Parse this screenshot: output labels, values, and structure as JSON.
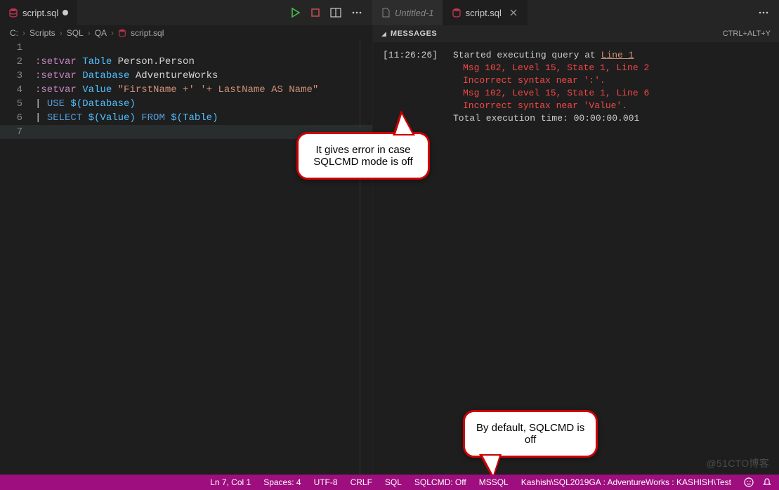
{
  "tabs": {
    "left": {
      "name": "script.sql"
    },
    "right_inactive": "Untitled-1",
    "right_active": "script.sql"
  },
  "editor_actions": {
    "run_tip": "Run",
    "stop_tip": "Stop",
    "split_tip": "Split",
    "more_tip": "More"
  },
  "breadcrumb": {
    "p0": "C:",
    "p1": "Scripts",
    "p2": "SQL",
    "p3": "QA",
    "p4": "script.sql"
  },
  "code": {
    "l1": "",
    "l2_key": ":setvar ",
    "l2_var": "Table",
    "l2_rest": " Person.Person",
    "l3_key": ":setvar ",
    "l3_var": "Database",
    "l3_rest": " AdventureWorks",
    "l4_key": ":setvar ",
    "l4_var": "Value ",
    "l4_str": "\"FirstName +' '+ LastName AS Name\"",
    "l5_pipe": "| ",
    "l5_use": "USE ",
    "l5_db": "$(Database)",
    "l6_pipe": "| ",
    "l6_sel": "SELECT ",
    "l6_v": "$(Value)",
    "l6_from": " FROM ",
    "l6_t": "$(Table)",
    "l7": ""
  },
  "results": {
    "header": "MESSAGES",
    "shortcut": "CTRL+ALT+Y",
    "time": "[11:26:26]",
    "started_prefix": "Started executing query at ",
    "started_link": "Line 1",
    "err1": "Msg 102, Level 15, State 1, Line 2",
    "err2": "Incorrect syntax near ':'.",
    "err3": "Msg 102, Level 15, State 1, Line 6",
    "err4": "Incorrect syntax near 'Value'.",
    "total": "Total execution time: 00:00:00.001"
  },
  "callouts": {
    "c1a": "It gives error in case",
    "c1b": "SQLCMD mode is off",
    "c2a": "By default, SQLCMD is",
    "c2b": "off"
  },
  "statusbar": {
    "pos": "Ln 7, Col 1",
    "spaces": "Spaces: 4",
    "enc": "UTF-8",
    "eol": "CRLF",
    "lang": "SQL",
    "sqlcmd": "SQLCMD: Off",
    "driver": "MSSQL",
    "conn": "Kashish\\SQL2019GA : AdventureWorks : KASHISH\\Test"
  },
  "watermark": "@51CTO博客"
}
